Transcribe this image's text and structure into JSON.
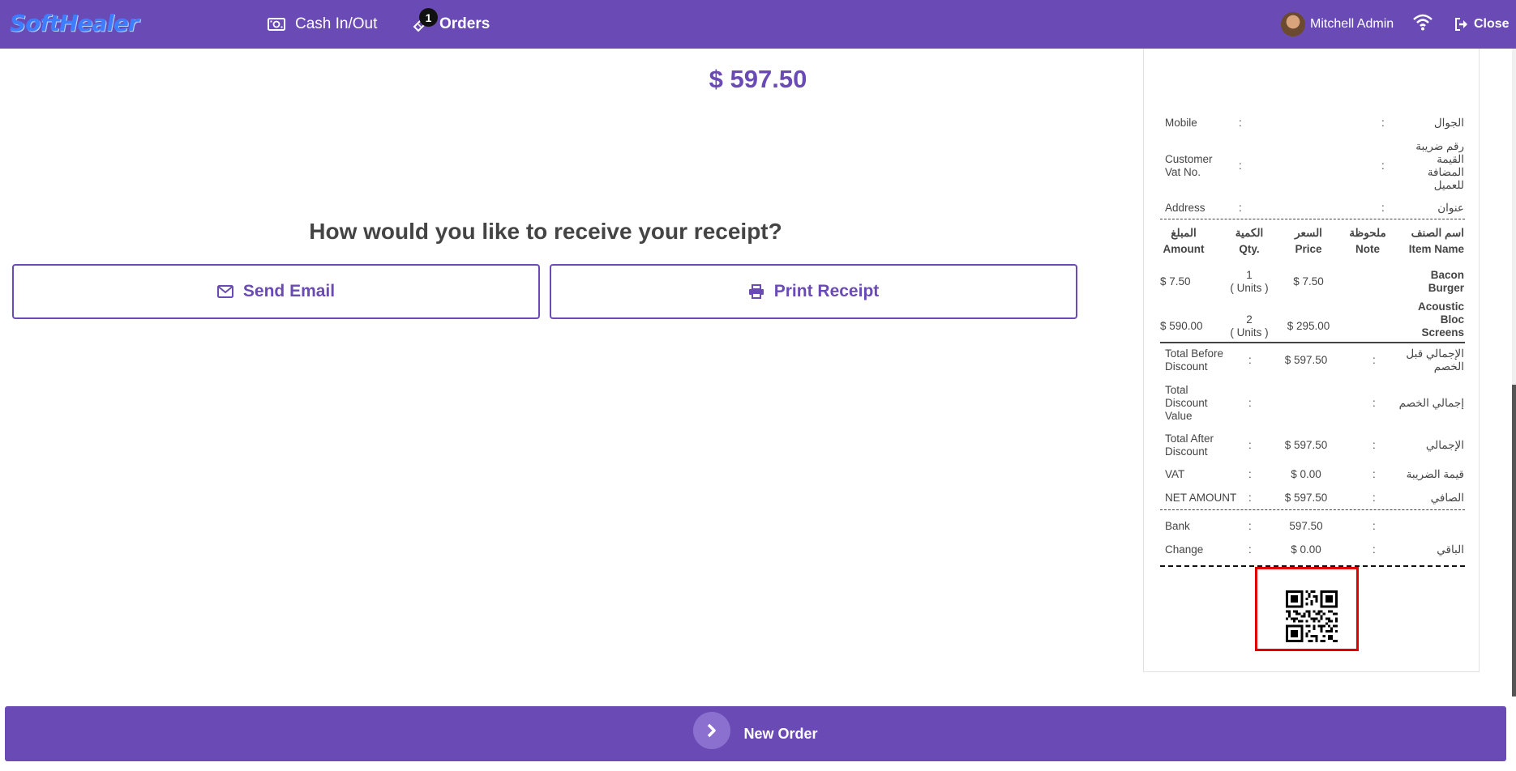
{
  "header": {
    "logo": "SoftHealer",
    "nav": {
      "cash": "Cash In/Out",
      "orders": "Orders",
      "orders_badge": "1"
    },
    "user": "Mitchell Admin",
    "close": "Close",
    "colors": {
      "bar": "#6a4bb6",
      "logo": "#3f7dff"
    }
  },
  "payment": {
    "total": "$ 597.50",
    "question": "How would you like to receive your receipt?",
    "email_label": "Send Email",
    "print_label": "Print Receipt"
  },
  "receipt": {
    "customer": [
      {
        "en": "Mobile",
        "ar": "الجوال"
      },
      {
        "en": "Customer Vat No.",
        "ar": "رقم ضريبة القيمة المضافة للعميل"
      },
      {
        "en": "Address",
        "ar": "عنوان"
      }
    ],
    "headers": [
      {
        "ar": "المبلغ",
        "en": "Amount"
      },
      {
        "ar": "الكمية",
        "en": "Qty."
      },
      {
        "ar": "السعر",
        "en": "Price"
      },
      {
        "ar": "ملحوظة",
        "en": "Note"
      },
      {
        "ar": "اسم الصنف",
        "en": "Item Name"
      }
    ],
    "items": [
      {
        "amount": "$ 7.50",
        "qty": "1",
        "unit": "( Units )",
        "price": "$ 7.50",
        "note": "",
        "name": "Bacon Burger"
      },
      {
        "amount": "$ 590.00",
        "qty": "2",
        "unit": "( Units )",
        "price": "$ 295.00",
        "note": "",
        "name": "Acoustic Bloc Screens"
      }
    ],
    "totals": [
      {
        "en": "Total Before Discount",
        "value": "$ 597.50",
        "ar": "الإجمالي قبل الخصم"
      },
      {
        "en": "Total Discount Value",
        "value": "",
        "ar": "إجمالي الخصم"
      },
      {
        "en": "Total After Discount",
        "value": "$ 597.50",
        "ar": "الإجمالي"
      },
      {
        "en": "VAT",
        "value": "$ 0.00",
        "ar": "قيمة الضريبة"
      },
      {
        "en": "NET AMOUNT",
        "value": "$ 597.50",
        "ar": "الصافي"
      }
    ],
    "payments": [
      {
        "en": "Bank",
        "value": "597.50",
        "ar": ""
      },
      {
        "en": "Change",
        "value": "$ 0.00",
        "ar": "الباقي"
      }
    ],
    "colon": ":"
  },
  "footer": {
    "new_order": "New Order"
  }
}
